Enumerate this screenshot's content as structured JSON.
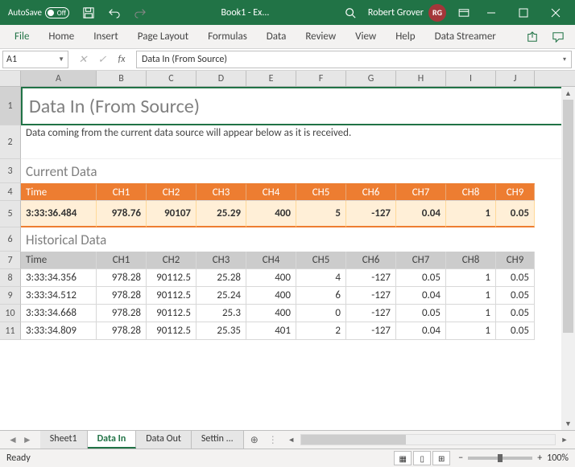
{
  "titlebar": {
    "autosave_label": "AutoSave",
    "autosave_state": "Off",
    "filename": "Book1  -  Ex...",
    "user_name": "Robert Grover",
    "user_initials": "RG"
  },
  "ribbon": {
    "tabs": [
      "File",
      "Home",
      "Insert",
      "Page Layout",
      "Formulas",
      "Data",
      "Review",
      "View",
      "Help",
      "Data Streamer"
    ]
  },
  "formulabar": {
    "namebox": "A1",
    "formula": "Data In (From Source)"
  },
  "columns": [
    "A",
    "B",
    "C",
    "D",
    "E",
    "F",
    "G",
    "H",
    "I",
    "J"
  ],
  "rownums": [
    "1",
    "2",
    "3",
    "4",
    "5",
    "6",
    "7",
    "8",
    "9",
    "10",
    "11"
  ],
  "content": {
    "title": "Data In (From Source)",
    "subtitle": "Data coming from the current data source will appear below as it is received.",
    "current_label": "Current Data",
    "historical_label": "Historical Data",
    "channel_headers": [
      "Time",
      "CH1",
      "CH2",
      "CH3",
      "CH4",
      "CH5",
      "CH6",
      "CH7",
      "CH8",
      "CH9"
    ],
    "current_row": [
      "3:33:36.484",
      "978.76",
      "90107",
      "25.29",
      "400",
      "5",
      "-127",
      "0.04",
      "1",
      "0.05"
    ],
    "historical_rows": [
      [
        "3:33:34.356",
        "978.28",
        "90112.5",
        "25.28",
        "400",
        "4",
        "-127",
        "0.05",
        "1",
        "0.05"
      ],
      [
        "3:33:34.512",
        "978.28",
        "90112.5",
        "25.24",
        "400",
        "6",
        "-127",
        "0.04",
        "1",
        "0.05"
      ],
      [
        "3:33:34.668",
        "978.28",
        "90112.5",
        "25.3",
        "400",
        "0",
        "-127",
        "0.05",
        "1",
        "0.05"
      ],
      [
        "3:33:34.809",
        "978.28",
        "90112.5",
        "25.35",
        "401",
        "2",
        "-127",
        "0.04",
        "1",
        "0.05"
      ]
    ]
  },
  "sheets": {
    "tabs": [
      "Sheet1",
      "Data In",
      "Data Out",
      "Settin  ..."
    ],
    "active": 1
  },
  "status": {
    "left": "Ready",
    "zoom": "100%"
  }
}
